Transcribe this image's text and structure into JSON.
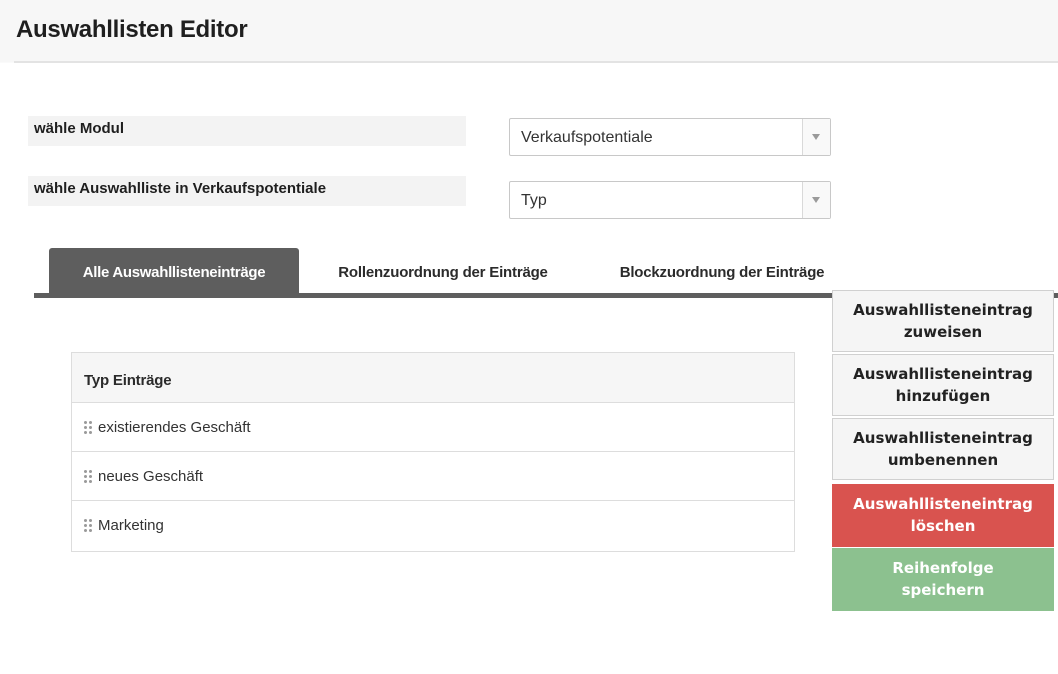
{
  "header": {
    "title": "Auswahllisten Editor"
  },
  "form": {
    "module_label": "wähle Modul",
    "module_value": "Verkaufspotentiale",
    "list_label": "wähle Auswahlliste in Verkaufspotentiale",
    "list_value": "Typ"
  },
  "tabs": [
    {
      "label": "Alle Auswahllisteneinträge",
      "active": true
    },
    {
      "label": "Rollenzuordnung der Einträge",
      "active": false
    },
    {
      "label": "Blockzuordnung der Einträge",
      "active": false
    }
  ],
  "table": {
    "header": "Typ Einträge",
    "rows": [
      {
        "label": "existierendes Geschäft"
      },
      {
        "label": "neues Geschäft"
      },
      {
        "label": "Marketing"
      }
    ]
  },
  "actions": {
    "assign": {
      "line1": "Auswahllisteneintrag",
      "line2": "zuweisen"
    },
    "add": {
      "line1": "Auswahllisteneintrag",
      "line2": "hinzufügen"
    },
    "rename": {
      "line1": "Auswahllisteneintrag",
      "line2": "umbenennen"
    },
    "delete": {
      "line1": "Auswahllisteneintrag",
      "line2": "löschen"
    },
    "save": {
      "line1": "Reihenfolge",
      "line2": "speichern"
    }
  },
  "colors": {
    "tab_active": "#5e5e5e",
    "delete_button": "#d9534f",
    "save_button": "#8cc18f"
  },
  "icons": {
    "dropdown": "chevron-down-icon",
    "drag": "drag-handle-icon"
  }
}
